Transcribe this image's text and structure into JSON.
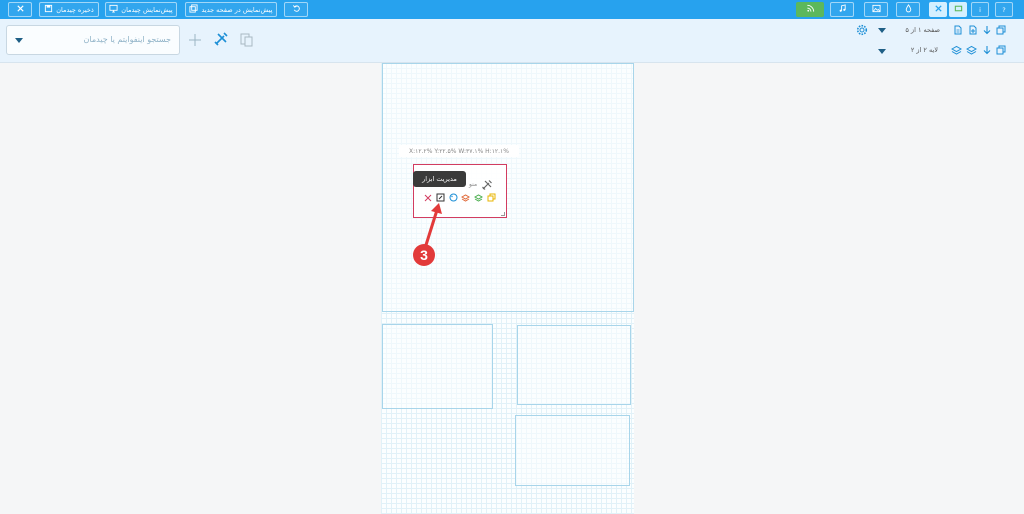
{
  "topbar": {
    "close_icon": "close-icon",
    "save_label": "ذخیره چیدمان",
    "preview_label": "پیش‌نمایش چیدمان",
    "preview_new_label": "پیش‌نمایش در صفحه جدید",
    "help_label": "?",
    "info_label": "i",
    "colors": {
      "bar": "#27a2ee",
      "active": "#d4f0ff",
      "green": "#5cb85c"
    }
  },
  "toolbar": {
    "search_placeholder": "جستجو اینفوایتم یا چیدمان",
    "page_label": "صفحه ۱ از ۵",
    "layer_label": "لایه ۲ از ۲"
  },
  "canvas": {
    "position_label": "X:۱۲.۲% Y:۲۲.۵% W:۳۷.۱% H:۱۲.۱%",
    "widget_text": "منو",
    "tooltip": "مدیریت ابزار",
    "step_marker": "3",
    "colors": {
      "selection": "#d23c60",
      "marker": "#e23a3a"
    }
  }
}
